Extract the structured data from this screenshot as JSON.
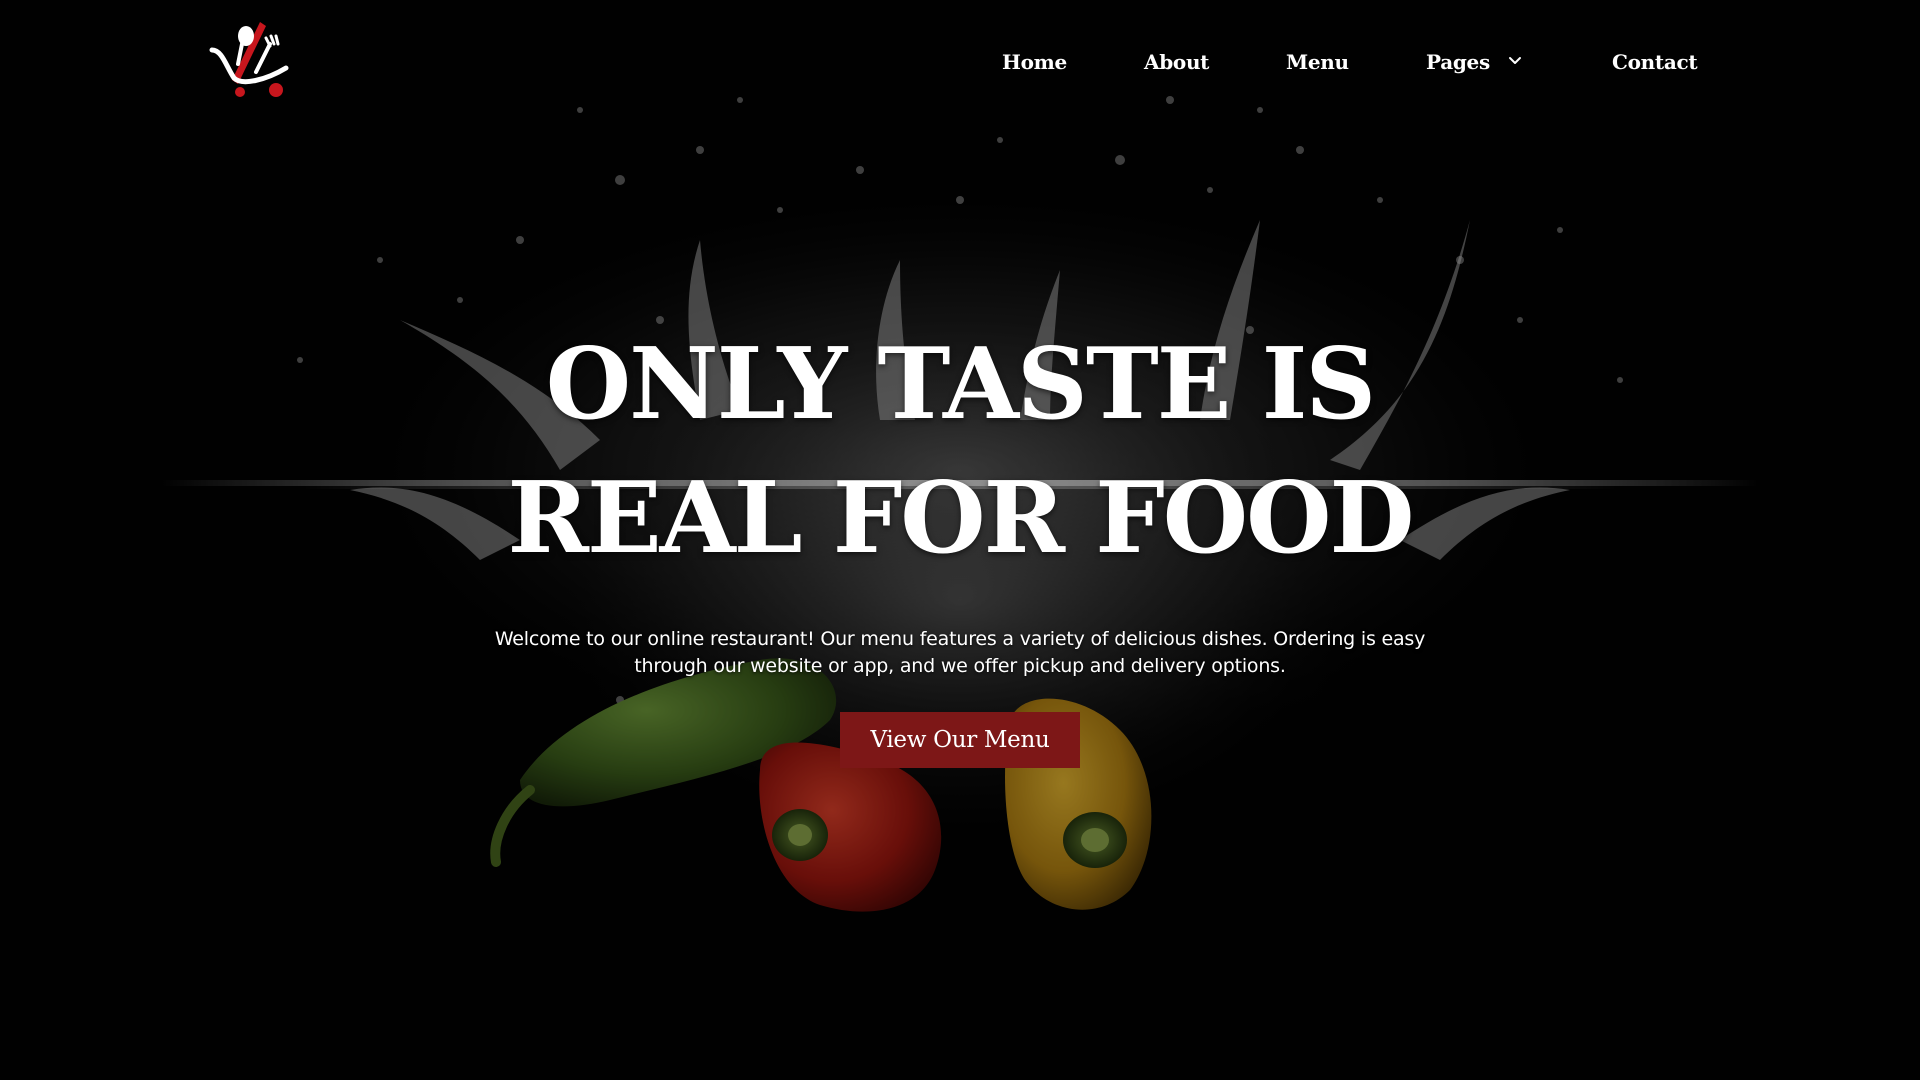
{
  "header": {
    "logo_icon": "restaurant-cart-utensils-logo",
    "nav": [
      {
        "label": "Home"
      },
      {
        "label": "About"
      },
      {
        "label": "Menu"
      },
      {
        "label": "Pages",
        "icon": "chevron-down-icon"
      },
      {
        "label": "Contact"
      }
    ]
  },
  "hero": {
    "title_line1": "ONLY TASTE IS",
    "title_line2": "REAL FOR FOOD",
    "description_line1": "Welcome to our online restaurant! Our menu features a variety of delicious dishes. Ordering is easy",
    "description_line2": "through our website or app, and we offer pickup and delivery options.",
    "cta_label": "View Our Menu"
  },
  "colors": {
    "background": "#020202",
    "accent": "#7d1717",
    "text": "#ffffff"
  }
}
